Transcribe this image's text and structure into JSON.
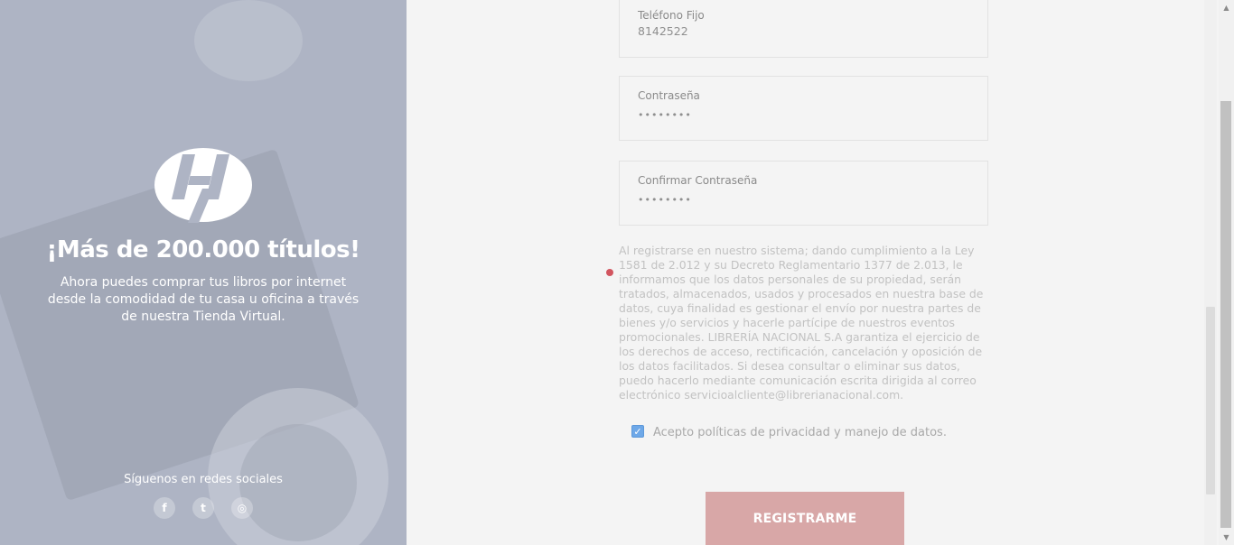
{
  "left_panel": {
    "headline": "¡Más de 200.000 títulos!",
    "subtext": "Ahora puedes comprar tus libros por internet desde la comodidad de tu casa u oficina a través de nuestra Tienda Virtual.",
    "social_label": "Síguenos en redes sociales",
    "social_icons": [
      {
        "name": "facebook-icon",
        "glyph": "f"
      },
      {
        "name": "twitter-icon",
        "glyph": "t"
      },
      {
        "name": "instagram-icon",
        "glyph": "◎"
      }
    ],
    "logo_icon": "brand-logo-icon"
  },
  "form": {
    "phone": {
      "label": "Teléfono Fijo",
      "value": "8142522"
    },
    "password": {
      "label": "Contraseña",
      "value": "••••••••"
    },
    "confirm_password": {
      "label": "Confirmar Contraseña",
      "value": "••••••••"
    },
    "legal_text": "Al registrarse en nuestro sistema; dando cumplimiento a la Ley 1581 de 2.012 y su Decreto Reglamentario 1377 de 2.013, le informamos que los datos personales de su propiedad, serán tratados, almacenados, usados y procesados en nuestra base de datos, cuya finalidad es gestionar el envío por nuestra partes de bienes y/o servicios y hacerle partícipe de nuestros eventos promocionales. LIBRERÍA NACIONAL S.A garantiza el ejercicio de los derechos de acceso, rectificación, cancelación y oposición de los datos facilitados. Si desea consultar o eliminar sus datos, puedo hacerlo mediante comunicación escrita dirigida al correo electrónico servicioalcliente@librerianacional.com.",
    "consent_label": "Acepto políticas de privacidad y manejo de datos.",
    "consent_checked": true,
    "submit_label": "REGISTRARME"
  },
  "colors": {
    "left_panel_bg": "#aeb4c4",
    "button_bg": "#d8a7a7",
    "checkbox_bg": "#6ea8e8",
    "indicator_dot": "#d2555f"
  }
}
